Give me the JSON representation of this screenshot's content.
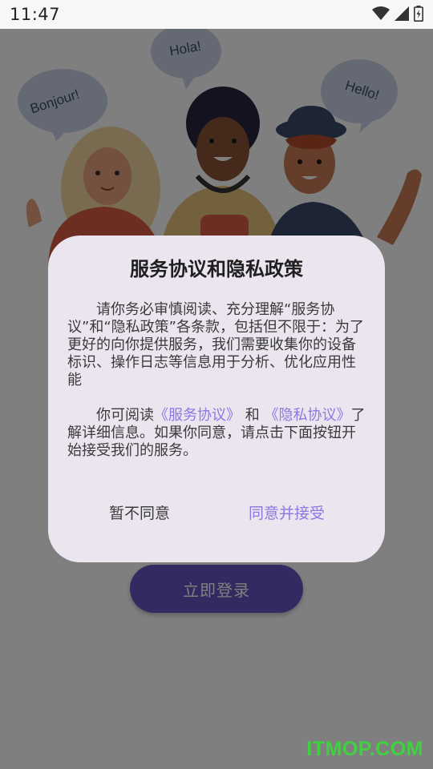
{
  "status_bar": {
    "time": "11:47",
    "icons": [
      "wifi-icon",
      "signal-icon",
      "battery-charging-icon"
    ]
  },
  "illustration": {
    "bubbles": [
      "Hola!",
      "Bonjour!",
      "Hello!"
    ]
  },
  "login": {
    "button_label": "立即登录"
  },
  "dialog": {
    "title": "服务协议和隐私政策",
    "paragraph1": "请你务必审慎阅读、充分理解“服务协议”和“隐私政策”各条款，包括但不限于：为了更好的向你提供服务，我们需要收集你的设备标识、操作日志等信息用于分析、优化应用性能",
    "p2_prefix": "你可阅读",
    "p2_link_service": "《服务协议》",
    "p2_and": " 和 ",
    "p2_link_privacy": "《隐私协议》",
    "p2_suffix": "了解详细信息。如果你同意，请点击下面按钮开始接受我们的服务。",
    "disagree_label": "暂不同意",
    "agree_label": "同意并接受"
  },
  "watermark": "ITMOP.COM",
  "colors": {
    "accent": "#8c78e0",
    "login_button": "#6a52c4",
    "dialog_bg": "#ebe5f0",
    "watermark": "#3fd13f"
  }
}
